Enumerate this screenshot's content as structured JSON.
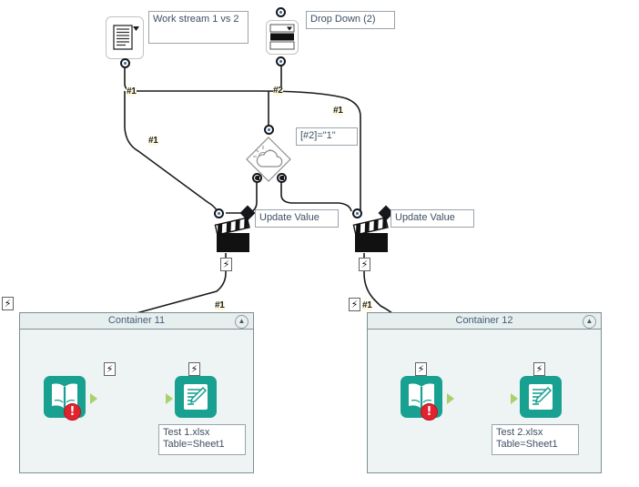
{
  "diagram": {
    "title": "workflow-canvas",
    "colors": {
      "teal": "#18a091",
      "error_red": "#e0232e",
      "wire": "#1a1a1a",
      "label_text": "#3f4f63",
      "container_border": "#7d8f93",
      "container_fill": "#eef3f3",
      "green_port": "#a8d16b"
    }
  },
  "nodes": {
    "source_doc": {
      "name": "document-source-node",
      "icon": "document-list-icon"
    },
    "dropdown": {
      "name": "drop-down-node",
      "icon": "drop-down-icon"
    },
    "condition": {
      "name": "condition-node",
      "icon": "weather-condition-icon"
    },
    "update_value_1": {
      "name": "update-value-node-1",
      "icon": "clapperboard-icon"
    },
    "update_value_2": {
      "name": "update-value-node-2",
      "icon": "clapperboard-icon"
    }
  },
  "labels": {
    "work_stream": "Work stream 1 vs 2",
    "drop_down": "Drop Down (2)",
    "condition_expr": "[#2]=\"1\"",
    "update_value_1": "Update Value",
    "update_value_2": "Update Value",
    "file_1": "Test 1.xlsx\nTable=Sheet1",
    "file_2": "Test 2.xlsx\nTable=Sheet1"
  },
  "wire_tags": {
    "doc_out": "#1",
    "dropdown_out": "#2",
    "branch_right": "#1",
    "doc_down": "#1",
    "container11_in": "#1",
    "container12_in": "#1"
  },
  "containers": [
    {
      "title": "Container 11",
      "collapse_icon": "chevron-up-icon",
      "read_node": {
        "name": "read-excel-node",
        "icon": "open-book-icon",
        "status": "error",
        "status_glyph": "!"
      },
      "write_node": {
        "name": "write-excel-node",
        "icon": "document-edit-icon"
      },
      "file_label": "Test 1.xlsx\nTable=Sheet1",
      "bolt_in": "lightning-icon",
      "bolt_write": "lightning-icon"
    },
    {
      "title": "Container 12",
      "collapse_icon": "chevron-up-icon",
      "read_node": {
        "name": "read-excel-node",
        "icon": "open-book-icon",
        "status": "error",
        "status_glyph": "!"
      },
      "write_node": {
        "name": "write-excel-node",
        "icon": "document-edit-icon"
      },
      "file_label": "Test 2.xlsx\nTable=Sheet1",
      "bolt_in": "lightning-icon",
      "bolt_write": "lightning-icon"
    }
  ],
  "glyphs": {
    "bolt": "⚡",
    "chevron_up": "▲",
    "caret_down": "▼",
    "exclamation": "!"
  }
}
